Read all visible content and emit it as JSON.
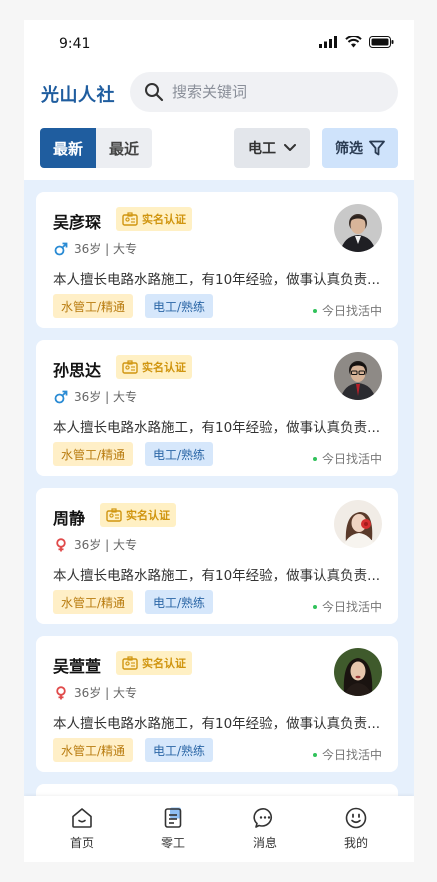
{
  "status_bar": {
    "time": "9:41"
  },
  "header": {
    "brand": "光山人社",
    "search_placeholder": "搜索关键词"
  },
  "filters": {
    "tabs": [
      {
        "label": "最新",
        "active": true
      },
      {
        "label": "最近",
        "active": false
      }
    ],
    "dropdown_label": "电工",
    "screen_label": "筛选"
  },
  "colors": {
    "primary": "#1f5d9f",
    "list_bg": "#e6f0fc",
    "male": "#2a8bd4",
    "female": "#e04a4a",
    "badge_text": "#d0950f",
    "active_dot": "#31c25b"
  },
  "workers": [
    {
      "name": "吴彦琛",
      "badge": "实名认证",
      "gender": "male",
      "gender_icon": "male-icon",
      "meta": "36岁 | 大专",
      "desc": "本人擅长电路水路施工，有10年经验，做事认真负责...",
      "tags": [
        "水管工/精通",
        "电工/熟练"
      ],
      "active": "今日找活中",
      "avatar": "man-in-suit"
    },
    {
      "name": "孙思达",
      "badge": "实名认证",
      "gender": "male",
      "gender_icon": "male-icon",
      "meta": "36岁 | 大专",
      "desc": "本人擅长电路水路施工，有10年经验，做事认真负责...",
      "tags": [
        "水管工/精通",
        "电工/熟练"
      ],
      "active": "今日找活中",
      "avatar": "man-with-glasses"
    },
    {
      "name": "周静",
      "badge": "实名认证",
      "gender": "female",
      "gender_icon": "female-icon",
      "meta": "36岁 | 大专",
      "desc": "本人擅长电路水路施工，有10年经验，做事认真负责...",
      "tags": [
        "水管工/精通",
        "电工/熟练"
      ],
      "active": "今日找活中",
      "avatar": "woman-with-flower"
    },
    {
      "name": "吴萱萱",
      "badge": "实名认证",
      "gender": "female",
      "gender_icon": "female-icon",
      "meta": "36岁 | 大专",
      "desc": "本人擅长电路水路施工，有10年经验，做事认真负责...",
      "tags": [
        "水管工/精通",
        "电工/熟练"
      ],
      "active": "今日找活中",
      "avatar": "woman-dark-hair"
    }
  ],
  "nav": [
    {
      "label": "首页",
      "icon": "home-icon",
      "active": false
    },
    {
      "label": "零工",
      "icon": "clipboard-icon",
      "active": true
    },
    {
      "label": "消息",
      "icon": "chat-icon",
      "active": false
    },
    {
      "label": "我的",
      "icon": "smile-icon",
      "active": false
    }
  ]
}
